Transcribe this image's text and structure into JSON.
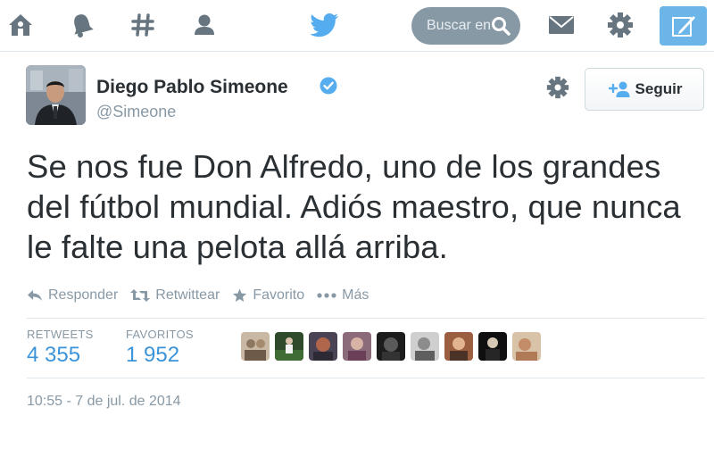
{
  "nav": {
    "icons": [
      "home-icon",
      "bell-icon",
      "hashtag-icon",
      "person-icon",
      "twitter-bird-icon",
      "mail-icon",
      "gear-icon",
      "compose-icon"
    ],
    "search_placeholder": "Buscar en",
    "accent": "#55acee"
  },
  "tweet": {
    "author_name": "Diego Pablo Simeone",
    "handle": "@Simeone",
    "verified": true,
    "follow_label": "Seguir",
    "text": "Se nos fue Don Alfredo, uno de los grandes del fútbol mundial. Adiós maestro, que nunca le falte una pelota allá arriba.",
    "actions": [
      {
        "icon": "reply-icon",
        "label": "Responder"
      },
      {
        "icon": "retweet-icon",
        "label": "Retwittear"
      },
      {
        "icon": "star-icon",
        "label": "Favorito"
      },
      {
        "icon": "more-icon",
        "label": "Más"
      }
    ],
    "stats": {
      "retweets_label": "RETWEETS",
      "retweets_value": "4 355",
      "favorites_label": "FAVORITOS",
      "favorites_value": "1 952"
    },
    "timestamp": "10:55 - 7 de jul. de 2014"
  },
  "colors": {
    "text": "#292f33",
    "muted": "#8899a6",
    "link": "#3b94d9",
    "verified": "#55acee"
  }
}
